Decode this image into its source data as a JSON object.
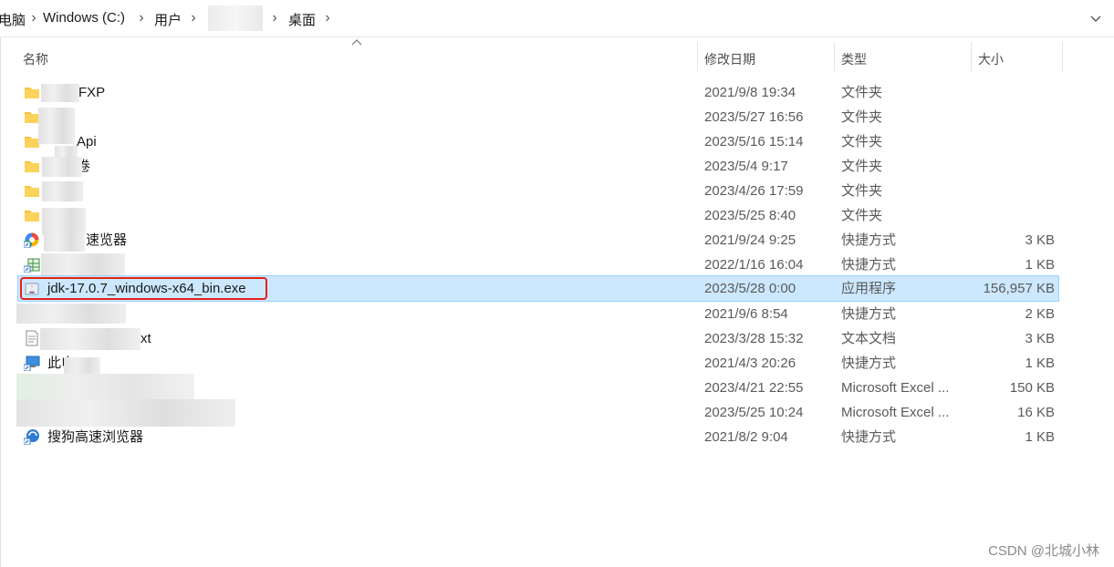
{
  "breadcrumb": {
    "items": [
      "电脑",
      "Windows (C:)",
      "用户",
      "",
      "桌面"
    ]
  },
  "columns": {
    "name": "名称",
    "date": "修改日期",
    "type": "类型",
    "size": "大小"
  },
  "rows": [
    {
      "name": "FXP",
      "date": "2021/9/8 19:34",
      "type": "文件夹",
      "size": "",
      "icon": "folder-icon"
    },
    {
      "name": "",
      "date": "2023/5/27 16:56",
      "type": "文件夹",
      "size": "",
      "icon": "folder-icon"
    },
    {
      "name": "Api",
      "date": "2023/5/16 15:14",
      "type": "文件夹",
      "size": "",
      "icon": "folder-icon"
    },
    {
      "name": "卷",
      "date": "2023/5/4 9:17",
      "type": "文件夹",
      "size": "",
      "icon": "folder-icon"
    },
    {
      "name": "",
      "date": "2023/4/26 17:59",
      "type": "文件夹",
      "size": "",
      "icon": "folder-icon"
    },
    {
      "name": "",
      "date": "2023/5/25 8:40",
      "type": "文件夹",
      "size": "",
      "icon": "folder-icon"
    },
    {
      "name": "速览器",
      "date": "2021/9/24 9:25",
      "type": "快捷方式",
      "size": "3 KB",
      "icon": "browser-shortcut-icon"
    },
    {
      "name": "",
      "date": "2022/1/16 16:04",
      "type": "快捷方式",
      "size": "1 KB",
      "icon": "spreadsheet-shortcut-icon"
    },
    {
      "name": "jdk-17.0.7_windows-x64_bin.exe",
      "date": "2023/5/28 0:00",
      "type": "应用程序",
      "size": "156,957 KB",
      "icon": "java-installer-icon"
    },
    {
      "name": "",
      "date": "2021/9/6 8:54",
      "type": "快捷方式",
      "size": "2 KB",
      "icon": "shortcut-icon"
    },
    {
      "name": "xt",
      "date": "2023/3/28 15:32",
      "type": "文本文档",
      "size": "3 KB",
      "icon": "text-file-icon"
    },
    {
      "name": "此电",
      "date": "2021/4/3 20:26",
      "type": "快捷方式",
      "size": "1 KB",
      "icon": "computer-shortcut-icon"
    },
    {
      "name": "",
      "date": "2023/4/21 22:55",
      "type": "Microsoft Excel ...",
      "size": "150 KB",
      "icon": "excel-file-icon"
    },
    {
      "name": "",
      "date": "2023/5/25 10:24",
      "type": "Microsoft Excel ...",
      "size": "16 KB",
      "icon": "excel-file-icon"
    },
    {
      "name": "搜狗高速浏览器",
      "date": "2021/8/2 9:04",
      "type": "快捷方式",
      "size": "1 KB",
      "icon": "sogou-browser-icon"
    }
  ],
  "selected_index": 8,
  "watermark": "CSDN @北城小林",
  "colors": {
    "selection": "#cce8ff",
    "highlight_border": "#e5211a",
    "folder": "#f8c23e"
  }
}
